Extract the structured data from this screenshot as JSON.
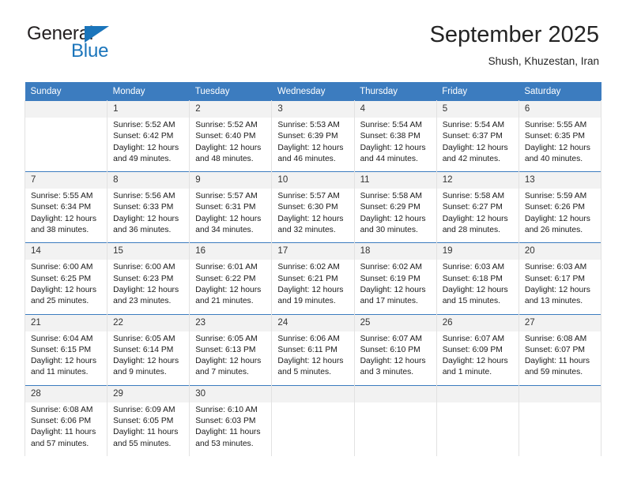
{
  "brand": {
    "word_one": "General",
    "word_two": "Blue",
    "triangle_icon": "triangle-icon",
    "accent_color": "#1b75bb"
  },
  "header": {
    "title": "September 2025",
    "subtitle": "Shush, Khuzestan, Iran"
  },
  "calendar": {
    "header_bg": "#3c7cbf",
    "daynum_bg": "#f2f2f2",
    "weekdays": [
      "Sunday",
      "Monday",
      "Tuesday",
      "Wednesday",
      "Thursday",
      "Friday",
      "Saturday"
    ],
    "weeks": [
      [
        {
          "day": "",
          "blank": true,
          "sunrise": "",
          "sunset": "",
          "daylight": ""
        },
        {
          "day": "1",
          "sunrise": "Sunrise: 5:52 AM",
          "sunset": "Sunset: 6:42 PM",
          "daylight": "Daylight: 12 hours and 49 minutes."
        },
        {
          "day": "2",
          "sunrise": "Sunrise: 5:52 AM",
          "sunset": "Sunset: 6:40 PM",
          "daylight": "Daylight: 12 hours and 48 minutes."
        },
        {
          "day": "3",
          "sunrise": "Sunrise: 5:53 AM",
          "sunset": "Sunset: 6:39 PM",
          "daylight": "Daylight: 12 hours and 46 minutes."
        },
        {
          "day": "4",
          "sunrise": "Sunrise: 5:54 AM",
          "sunset": "Sunset: 6:38 PM",
          "daylight": "Daylight: 12 hours and 44 minutes."
        },
        {
          "day": "5",
          "sunrise": "Sunrise: 5:54 AM",
          "sunset": "Sunset: 6:37 PM",
          "daylight": "Daylight: 12 hours and 42 minutes."
        },
        {
          "day": "6",
          "sunrise": "Sunrise: 5:55 AM",
          "sunset": "Sunset: 6:35 PM",
          "daylight": "Daylight: 12 hours and 40 minutes."
        }
      ],
      [
        {
          "day": "7",
          "sunrise": "Sunrise: 5:55 AM",
          "sunset": "Sunset: 6:34 PM",
          "daylight": "Daylight: 12 hours and 38 minutes."
        },
        {
          "day": "8",
          "sunrise": "Sunrise: 5:56 AM",
          "sunset": "Sunset: 6:33 PM",
          "daylight": "Daylight: 12 hours and 36 minutes."
        },
        {
          "day": "9",
          "sunrise": "Sunrise: 5:57 AM",
          "sunset": "Sunset: 6:31 PM",
          "daylight": "Daylight: 12 hours and 34 minutes."
        },
        {
          "day": "10",
          "sunrise": "Sunrise: 5:57 AM",
          "sunset": "Sunset: 6:30 PM",
          "daylight": "Daylight: 12 hours and 32 minutes."
        },
        {
          "day": "11",
          "sunrise": "Sunrise: 5:58 AM",
          "sunset": "Sunset: 6:29 PM",
          "daylight": "Daylight: 12 hours and 30 minutes."
        },
        {
          "day": "12",
          "sunrise": "Sunrise: 5:58 AM",
          "sunset": "Sunset: 6:27 PM",
          "daylight": "Daylight: 12 hours and 28 minutes."
        },
        {
          "day": "13",
          "sunrise": "Sunrise: 5:59 AM",
          "sunset": "Sunset: 6:26 PM",
          "daylight": "Daylight: 12 hours and 26 minutes."
        }
      ],
      [
        {
          "day": "14",
          "sunrise": "Sunrise: 6:00 AM",
          "sunset": "Sunset: 6:25 PM",
          "daylight": "Daylight: 12 hours and 25 minutes."
        },
        {
          "day": "15",
          "sunrise": "Sunrise: 6:00 AM",
          "sunset": "Sunset: 6:23 PM",
          "daylight": "Daylight: 12 hours and 23 minutes."
        },
        {
          "day": "16",
          "sunrise": "Sunrise: 6:01 AM",
          "sunset": "Sunset: 6:22 PM",
          "daylight": "Daylight: 12 hours and 21 minutes."
        },
        {
          "day": "17",
          "sunrise": "Sunrise: 6:02 AM",
          "sunset": "Sunset: 6:21 PM",
          "daylight": "Daylight: 12 hours and 19 minutes."
        },
        {
          "day": "18",
          "sunrise": "Sunrise: 6:02 AM",
          "sunset": "Sunset: 6:19 PM",
          "daylight": "Daylight: 12 hours and 17 minutes."
        },
        {
          "day": "19",
          "sunrise": "Sunrise: 6:03 AM",
          "sunset": "Sunset: 6:18 PM",
          "daylight": "Daylight: 12 hours and 15 minutes."
        },
        {
          "day": "20",
          "sunrise": "Sunrise: 6:03 AM",
          "sunset": "Sunset: 6:17 PM",
          "daylight": "Daylight: 12 hours and 13 minutes."
        }
      ],
      [
        {
          "day": "21",
          "sunrise": "Sunrise: 6:04 AM",
          "sunset": "Sunset: 6:15 PM",
          "daylight": "Daylight: 12 hours and 11 minutes."
        },
        {
          "day": "22",
          "sunrise": "Sunrise: 6:05 AM",
          "sunset": "Sunset: 6:14 PM",
          "daylight": "Daylight: 12 hours and 9 minutes."
        },
        {
          "day": "23",
          "sunrise": "Sunrise: 6:05 AM",
          "sunset": "Sunset: 6:13 PM",
          "daylight": "Daylight: 12 hours and 7 minutes."
        },
        {
          "day": "24",
          "sunrise": "Sunrise: 6:06 AM",
          "sunset": "Sunset: 6:11 PM",
          "daylight": "Daylight: 12 hours and 5 minutes."
        },
        {
          "day": "25",
          "sunrise": "Sunrise: 6:07 AM",
          "sunset": "Sunset: 6:10 PM",
          "daylight": "Daylight: 12 hours and 3 minutes."
        },
        {
          "day": "26",
          "sunrise": "Sunrise: 6:07 AM",
          "sunset": "Sunset: 6:09 PM",
          "daylight": "Daylight: 12 hours and 1 minute."
        },
        {
          "day": "27",
          "sunrise": "Sunrise: 6:08 AM",
          "sunset": "Sunset: 6:07 PM",
          "daylight": "Daylight: 11 hours and 59 minutes."
        }
      ],
      [
        {
          "day": "28",
          "sunrise": "Sunrise: 6:08 AM",
          "sunset": "Sunset: 6:06 PM",
          "daylight": "Daylight: 11 hours and 57 minutes."
        },
        {
          "day": "29",
          "sunrise": "Sunrise: 6:09 AM",
          "sunset": "Sunset: 6:05 PM",
          "daylight": "Daylight: 11 hours and 55 minutes."
        },
        {
          "day": "30",
          "sunrise": "Sunrise: 6:10 AM",
          "sunset": "Sunset: 6:03 PM",
          "daylight": "Daylight: 11 hours and 53 minutes."
        },
        {
          "day": "",
          "blank": true,
          "sunrise": "",
          "sunset": "",
          "daylight": ""
        },
        {
          "day": "",
          "blank": true,
          "sunrise": "",
          "sunset": "",
          "daylight": ""
        },
        {
          "day": "",
          "blank": true,
          "sunrise": "",
          "sunset": "",
          "daylight": ""
        },
        {
          "day": "",
          "blank": true,
          "sunrise": "",
          "sunset": "",
          "daylight": ""
        }
      ]
    ]
  }
}
